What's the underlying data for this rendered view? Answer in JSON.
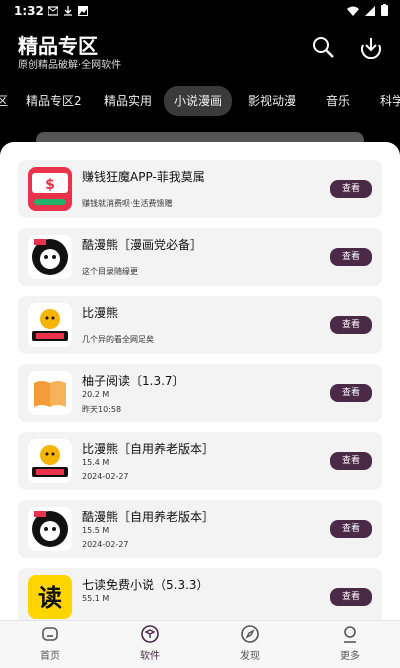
{
  "status_bar": {
    "time": "1:32",
    "icons": [
      "email-icon",
      "download-icon",
      "photo-icon",
      "wifi-icon",
      "battery-icon"
    ]
  },
  "header": {
    "title": "精品专区",
    "subtitle": "原创精品破解·全网软件"
  },
  "tabs": [
    {
      "label": "区"
    },
    {
      "label": "精品专区2"
    },
    {
      "label": "精品实用"
    },
    {
      "label": "小说漫画"
    },
    {
      "label": "影视动漫"
    },
    {
      "label": "音乐"
    },
    {
      "label": "科学"
    }
  ],
  "active_tab": "小说漫画",
  "accent_color": "#4b2a48",
  "items": [
    {
      "title": "赚钱狂魔APP-菲我莫属",
      "meta1": "赚钱就消费呗·生活费馈赠",
      "meta2": "",
      "button": "查看",
      "icon": "money-app-icon"
    },
    {
      "title": "酷漫熊［漫画党必备］",
      "meta1": "这个目录随缘更",
      "meta2": "",
      "button": "查看",
      "icon": "bear-comic-icon"
    },
    {
      "title": "比漫熊",
      "meta1": "几个异的看全网足矣",
      "meta2": "",
      "button": "查看",
      "icon": "bimanxiong-icon"
    },
    {
      "title": "柚子阅读〔1.3.7〕",
      "meta1": "20.2 M",
      "meta2": "昨天10:58",
      "button": "查看",
      "icon": "book-icon"
    },
    {
      "title": "比漫熊［自用养老版本］",
      "meta1": "15.4 M",
      "meta2": "2024-02-27",
      "button": "查看",
      "icon": "bimanxiong-icon"
    },
    {
      "title": "酷漫熊［自用养老版本］",
      "meta1": "15.5 M",
      "meta2": "2024-02-27",
      "button": "查看",
      "icon": "bear-comic-icon"
    },
    {
      "title": "七读免费小说（5.3.3）",
      "meta1": "55.1 M",
      "meta2": "",
      "button": "查看",
      "icon": "qidu-icon"
    }
  ],
  "bottom_nav": [
    {
      "label": "首页",
      "icon": "home-icon"
    },
    {
      "label": "软件",
      "icon": "cube-icon"
    },
    {
      "label": "发现",
      "icon": "compass-icon"
    },
    {
      "label": "更多",
      "icon": "profile-icon"
    }
  ]
}
